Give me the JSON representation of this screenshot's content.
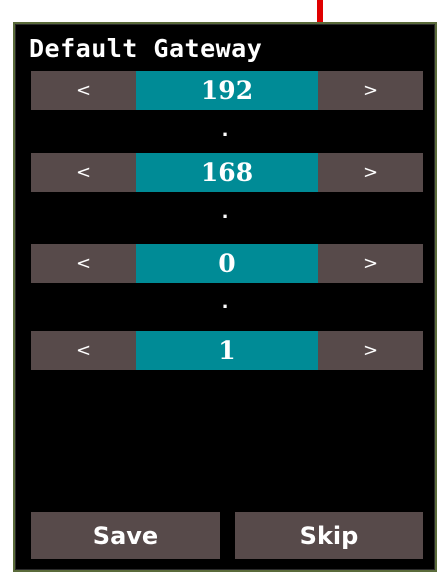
{
  "title": "Default Gateway",
  "octets": [
    {
      "decrement_label": "<",
      "value": "192",
      "increment_label": ">"
    },
    {
      "decrement_label": "<",
      "value": "168",
      "increment_label": ">"
    },
    {
      "decrement_label": "<",
      "value": "0",
      "increment_label": ">"
    },
    {
      "decrement_label": "<",
      "value": "1",
      "increment_label": ">"
    }
  ],
  "separators": [
    ".",
    ".",
    "."
  ],
  "actions": {
    "save_label": "Save",
    "skip_label": "Skip"
  },
  "colors": {
    "panel_background": "#000000",
    "button_background": "#574a4a",
    "value_background": "#008b96",
    "marker_arrow": "#e00000"
  },
  "icons": {
    "marker": "red-down-arrow-icon"
  }
}
